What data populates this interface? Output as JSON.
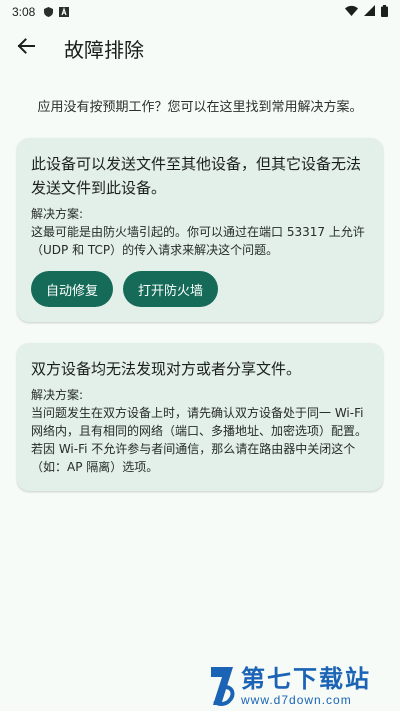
{
  "status_bar": {
    "time": "3:08",
    "icons": [
      "shield-icon",
      "font-icon",
      "wifi-icon",
      "signal-icon",
      "battery-icon"
    ]
  },
  "header": {
    "back_icon": "arrow-left-icon",
    "title": "故障排除"
  },
  "intro": "应用没有按预期工作？您可以在这里找到常用解决方案。",
  "cards": [
    {
      "title": "此设备可以发送文件至其他设备，但其它设备无法发送文件到此设备。",
      "solution_label": "解决方案:",
      "solution_text": "这最可能是由防火墙引起的。你可以通过在端口 53317 上允许（UDP 和 TCP）的传入请求来解决这个问题。",
      "actions": [
        "自动修复",
        "打开防火墙"
      ]
    },
    {
      "title": "双方设备均无法发现对方或者分享文件。",
      "solution_label": "解决方案:",
      "solution_text": "当问题发生在双方设备上时，请先确认双方设备处于同一 Wi-Fi 网络内，且有相同的网络（端口、多播地址、加密选项）配置。若因 Wi-Fi 不允许参与者间通信，那么请在路由器中关闭这个（如：AP 隔离）选项。"
    }
  ],
  "watermark": {
    "name": "第七下载站",
    "url": "www.d7down.com"
  },
  "colors": {
    "background": "#f6fbf8",
    "card": "#e3efe9",
    "accent": "#156b58",
    "watermark": "#1b63b5"
  }
}
